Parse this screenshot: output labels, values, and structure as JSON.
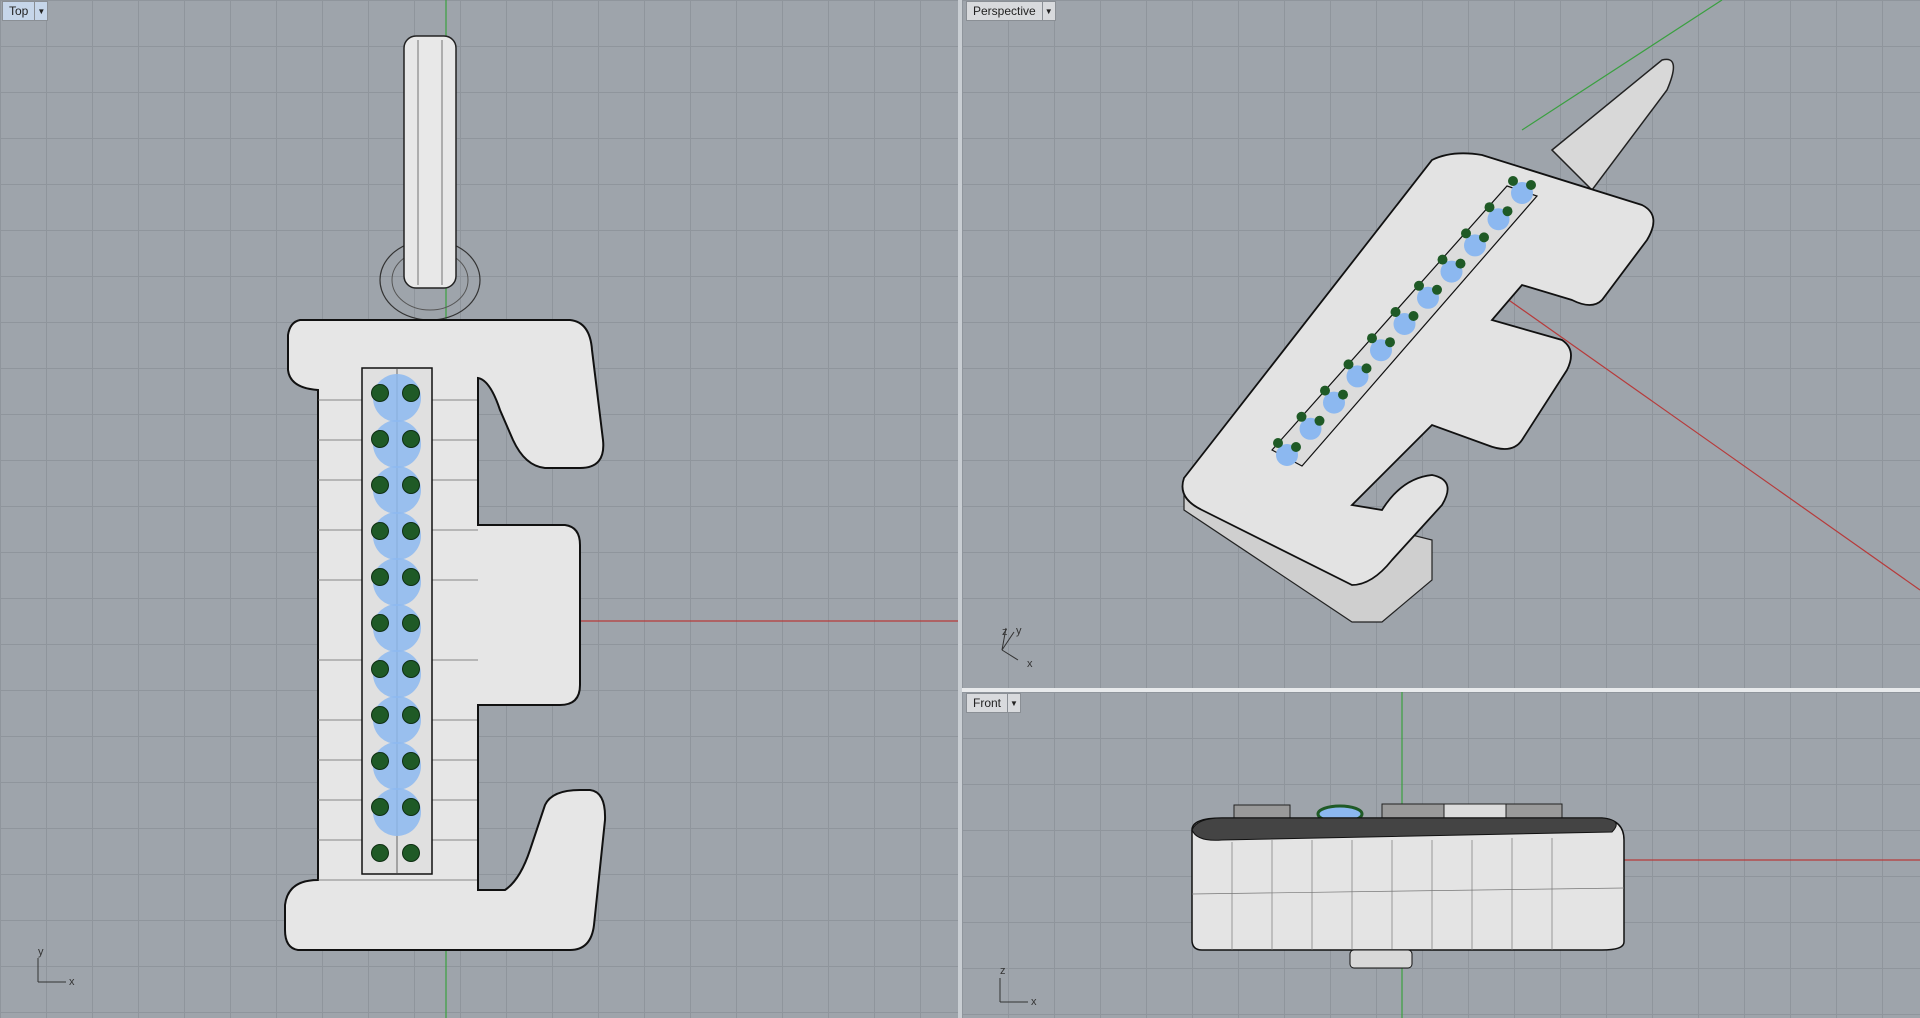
{
  "viewports": {
    "top": {
      "title": "Top",
      "axis_x": "x",
      "axis_y": "y"
    },
    "perspective": {
      "title": "Perspective",
      "axis_x": "x",
      "axis_y": "y",
      "axis_z": "z"
    },
    "front": {
      "title": "Front",
      "axis_x": "x",
      "axis_z": "z"
    }
  },
  "colors": {
    "viewport_bg": "#9ea4ab",
    "grid": "#8f959c",
    "x_axis": "#b73a3a",
    "y_axis": "#3aa040",
    "model_fill": "#e6e6e6",
    "gem_blue": "#8cb8f0",
    "gem_green": "#1f5a26",
    "active_tab": "#c6d6ea"
  },
  "icons": {
    "tab_menu": "chevron-down-icon"
  }
}
